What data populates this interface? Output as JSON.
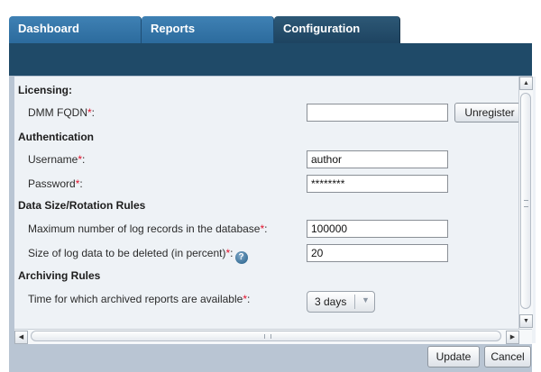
{
  "tabs": [
    {
      "label": "Dashboard"
    },
    {
      "label": "Reports"
    },
    {
      "label": "Configuration"
    }
  ],
  "licensing": {
    "heading": "Licensing:",
    "fqdn_label": "DMM FQDN",
    "fqdn_value": "",
    "unregister_label": "Unregister"
  },
  "authentication": {
    "heading": "Authentication",
    "username_label": "Username",
    "username_value": "author",
    "password_label": "Password",
    "password_value": "********"
  },
  "data_size": {
    "heading": "Data Size/Rotation Rules",
    "max_records_label": "Maximum number of log records in the database",
    "max_records_value": "100000",
    "delete_size_label": "Size of log data to be deleted (in percent)",
    "delete_size_value": "20"
  },
  "archiving": {
    "heading": "Archiving Rules",
    "time_label": "Time for which archived reports are available",
    "time_value": "3 days"
  },
  "required_marker": "*",
  "label_suffix": ":",
  "help_glyph": "?",
  "footer": {
    "update_label": "Update",
    "cancel_label": "Cancel"
  },
  "colors": {
    "tab": "#3f81b4",
    "active_tab": "#2d5876",
    "nav_strip": "#1f4a68",
    "background": "#b9c5d3",
    "required": "#e0102a"
  }
}
